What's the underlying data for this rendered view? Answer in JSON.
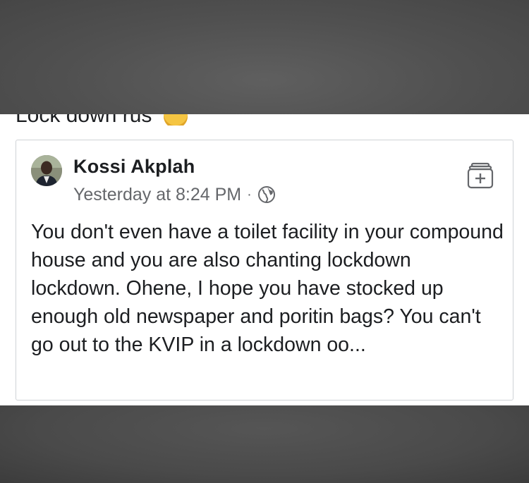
{
  "caption_fragment": "Lock down rus",
  "post": {
    "author": "Kossi Akplah",
    "timestamp": "Yesterday at 8:24 PM",
    "separator": "·",
    "privacy_icon": "globe-icon",
    "save_icon": "save-collection-icon",
    "text": "You don't even have a toilet facility in your compound house and you are also chanting lockdown lockdown. Ohene, I hope you have stocked up enough old newspaper and poritin bags? You can't go out to the KVIP in a lockdown oo..."
  },
  "colors": {
    "text_primary": "#1c1e21",
    "text_secondary": "#65676b",
    "card_border": "#cfd2d6",
    "overlay": "#4a4a4a"
  }
}
